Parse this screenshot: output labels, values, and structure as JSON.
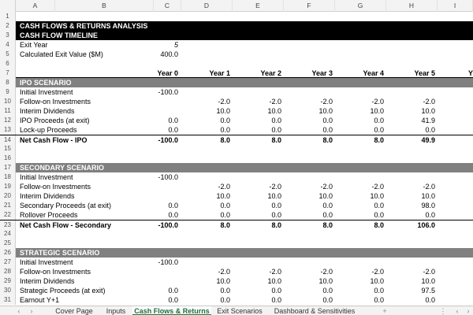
{
  "columns": [
    "A",
    "B",
    "C",
    "D",
    "E",
    "F",
    "G",
    "H",
    "I"
  ],
  "title": "CASH FLOWS & RETURNS ANALYSIS",
  "timeline_header": "CASH FLOW TIMELINE",
  "exit_year": {
    "label": "Exit Year",
    "value": "5"
  },
  "exit_value": {
    "label": "Calculated Exit Value ($M)",
    "value": "400.0"
  },
  "year_headers": [
    "Year 0",
    "Year 1",
    "Year 2",
    "Year 3",
    "Year 4",
    "Year 5",
    "Y"
  ],
  "ipo": {
    "header": "IPO SCENARIO",
    "rows": [
      {
        "label": "Initial Investment",
        "values": [
          "-100.0",
          "",
          "",
          "",
          "",
          ""
        ]
      },
      {
        "label": "Follow-on Investments",
        "values": [
          "",
          "-2.0",
          "-2.0",
          "-2.0",
          "-2.0",
          "-2.0"
        ]
      },
      {
        "label": "Interim Dividends",
        "values": [
          "",
          "10.0",
          "10.0",
          "10.0",
          "10.0",
          "10.0"
        ]
      },
      {
        "label": "IPO Proceeds (at exit)",
        "values": [
          "0.0",
          "0.0",
          "0.0",
          "0.0",
          "0.0",
          "41.9"
        ]
      },
      {
        "label": "Lock-up Proceeds",
        "values": [
          "0.0",
          "0.0",
          "0.0",
          "0.0",
          "0.0",
          "0.0"
        ]
      }
    ],
    "total": {
      "label": "Net Cash Flow - IPO",
      "values": [
        "-100.0",
        "8.0",
        "8.0",
        "8.0",
        "8.0",
        "49.9"
      ]
    }
  },
  "secondary": {
    "header": "SECONDARY SCENARIO",
    "rows": [
      {
        "label": "Initial Investment",
        "values": [
          "-100.0",
          "",
          "",
          "",
          "",
          ""
        ]
      },
      {
        "label": "Follow-on Investments",
        "values": [
          "",
          "-2.0",
          "-2.0",
          "-2.0",
          "-2.0",
          "-2.0"
        ]
      },
      {
        "label": "Interim Dividends",
        "values": [
          "",
          "10.0",
          "10.0",
          "10.0",
          "10.0",
          "10.0"
        ]
      },
      {
        "label": "Secondary Proceeds (at exit)",
        "values": [
          "0.0",
          "0.0",
          "0.0",
          "0.0",
          "0.0",
          "98.0"
        ]
      },
      {
        "label": "Rollover Proceeds",
        "values": [
          "0.0",
          "0.0",
          "0.0",
          "0.0",
          "0.0",
          "0.0"
        ]
      }
    ],
    "total": {
      "label": "Net Cash Flow - Secondary",
      "values": [
        "-100.0",
        "8.0",
        "8.0",
        "8.0",
        "8.0",
        "106.0"
      ]
    }
  },
  "strategic": {
    "header": "STRATEGIC SCENARIO",
    "rows": [
      {
        "label": "Initial Investment",
        "values": [
          "-100.0",
          "",
          "",
          "",
          "",
          ""
        ]
      },
      {
        "label": "Follow-on Investments",
        "values": [
          "",
          "-2.0",
          "-2.0",
          "-2.0",
          "-2.0",
          "-2.0"
        ]
      },
      {
        "label": "Interim Dividends",
        "values": [
          "",
          "10.0",
          "10.0",
          "10.0",
          "10.0",
          "10.0"
        ]
      },
      {
        "label": "Strategic Proceeds (at exit)",
        "values": [
          "0.0",
          "0.0",
          "0.0",
          "0.0",
          "0.0",
          "97.5"
        ]
      },
      {
        "label": "Earnout Y+1",
        "values": [
          "0.0",
          "0.0",
          "0.0",
          "0.0",
          "0.0",
          "0.0"
        ]
      }
    ]
  },
  "row_numbers": [
    "1",
    "2",
    "3",
    "4",
    "5",
    "6",
    "7",
    "8",
    "9",
    "10",
    "11",
    "12",
    "13",
    "14",
    "15",
    "16",
    "17",
    "18",
    "19",
    "20",
    "21",
    "22",
    "23",
    "24",
    "25",
    "26",
    "27",
    "28",
    "29",
    "30",
    "31"
  ],
  "tabs": [
    "Cover Page",
    "Inputs",
    "Cash Flows & Returns",
    "Exit Scenarios",
    "Dashboard & Sensitivities"
  ],
  "active_tab": "Cash Flows & Returns",
  "nav": {
    "prev": "‹",
    "next": "›",
    "add": "+",
    "more": "⋮"
  }
}
